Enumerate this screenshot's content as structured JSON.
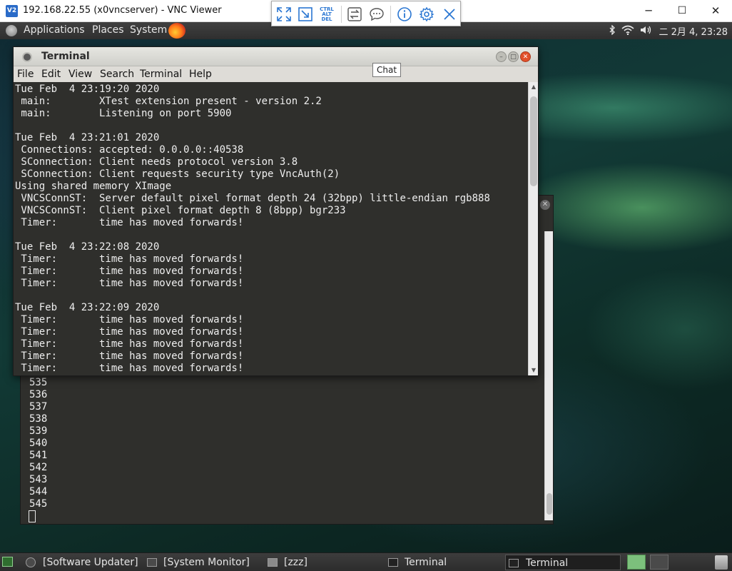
{
  "vnc": {
    "app_icon": "V2",
    "title": "192.168.22.55 (x0vncserver) - VNC Viewer",
    "minimize": "─",
    "maximize": "☐",
    "close": "✕"
  },
  "top_panel": {
    "menus": [
      "Applications",
      "Places",
      "System"
    ],
    "clock": "二 2月  4, 23:28",
    "tray_icons": [
      "bluetooth-icon",
      "wifi-icon",
      "volume-icon"
    ]
  },
  "vnc_toolbar": {
    "buttons": [
      "full-screen-icon",
      "scale-icon",
      "ctrl-alt-del-icon",
      "transfer-icon",
      "chat-icon",
      "info-icon",
      "settings-icon",
      "close-icon"
    ],
    "ctrl_alt_del": [
      "CTRL",
      "ALT",
      "DEL"
    ],
    "tooltip": "Chat",
    "accent": "#2a76d2"
  },
  "terminal": {
    "title": "Terminal",
    "menu": [
      "File",
      "Edit",
      "View",
      "Search",
      "Terminal",
      "Help"
    ],
    "lines": [
      "Tue Feb  4 23:19:20 2020",
      " main:        XTest extension present - version 2.2",
      " main:        Listening on port 5900",
      "",
      "Tue Feb  4 23:21:01 2020",
      " Connections: accepted: 0.0.0.0::40538",
      " SConnection: Client needs protocol version 3.8",
      " SConnection: Client requests security type VncAuth(2)",
      "Using shared memory XImage",
      " VNCSConnST:  Server default pixel format depth 24 (32bpp) little-endian rgb888",
      " VNCSConnST:  Client pixel format depth 8 (8bpp) bgr233",
      " Timer:       time has moved forwards!",
      "",
      "Tue Feb  4 23:22:08 2020",
      " Timer:       time has moved forwards!",
      " Timer:       time has moved forwards!",
      " Timer:       time has moved forwards!",
      "",
      "Tue Feb  4 23:22:09 2020",
      " Timer:       time has moved forwards!",
      " Timer:       time has moved forwards!",
      " Timer:       time has moved forwards!",
      " Timer:       time has moved forwards!",
      " Timer:       time has moved forwards!"
    ]
  },
  "back_terminal": {
    "lines": [
      "535",
      "536",
      "537",
      "538",
      "539",
      "540",
      "541",
      "542",
      "543",
      "544",
      "545"
    ]
  },
  "taskbar": {
    "tasks": [
      "[Software Updater]",
      "[System Monitor]",
      "[zzz]",
      "Terminal",
      "Terminal"
    ]
  }
}
